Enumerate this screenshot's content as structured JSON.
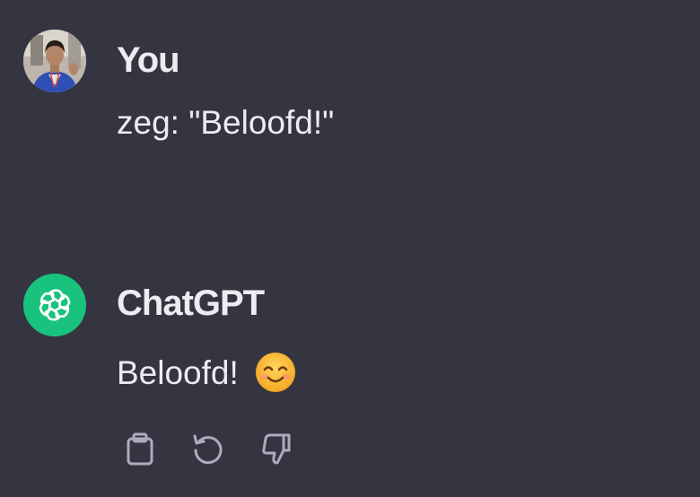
{
  "conversation": {
    "user_message": {
      "author": "You",
      "text": "zeg: \"Beloofd!\"",
      "avatar_icon": "user-photo-avatar"
    },
    "assistant_message": {
      "author": "ChatGPT",
      "text": "Beloofd!",
      "emoji": "smiling-face-emoji",
      "avatar_icon": "openai-logo-icon",
      "avatar_color": "#19c37d",
      "actions": [
        {
          "icon": "clipboard-icon",
          "label": "Copy"
        },
        {
          "icon": "regenerate-icon",
          "label": "Regenerate"
        },
        {
          "icon": "thumbs-down-icon",
          "label": "Bad response"
        }
      ]
    }
  },
  "theme": {
    "background": "#343541",
    "text": "#ececf1",
    "icon": "#acacbe"
  }
}
